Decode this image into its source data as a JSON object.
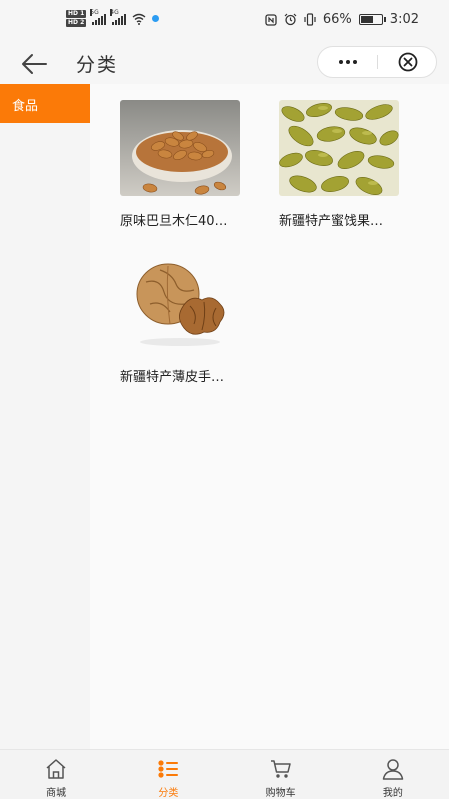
{
  "status_bar": {
    "hd1": "HD 1",
    "hd2": "HD 2",
    "net1": "5G",
    "net2": "4G",
    "battery": "66%",
    "battery_level": 0.66,
    "time": "3:02"
  },
  "header": {
    "title": "分类"
  },
  "sidebar": {
    "items": [
      {
        "label": "食品"
      }
    ]
  },
  "products": [
    {
      "name": "原味巴旦木仁40…",
      "icon": "almonds-image"
    },
    {
      "name": "新疆特产蜜饯果…",
      "icon": "raisins-image"
    },
    {
      "name": "新疆特产薄皮手…",
      "icon": "walnuts-image"
    }
  ],
  "tabbar": {
    "tabs": [
      {
        "label": "商城",
        "icon": "home-icon"
      },
      {
        "label": "分类",
        "icon": "category-icon"
      },
      {
        "label": "购物车",
        "icon": "cart-icon"
      },
      {
        "label": "我的",
        "icon": "user-icon"
      }
    ]
  },
  "colors": {
    "accent": "#fb7a08"
  }
}
